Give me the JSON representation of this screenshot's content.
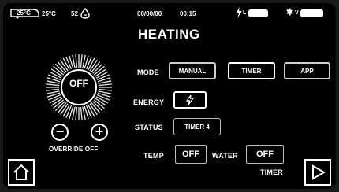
{
  "status_bar": {
    "cabin_temp": "25°C",
    "outside_temp": "25°C",
    "water_level": "52",
    "date": "00/00/00",
    "time": "00:15",
    "power_label": "L",
    "solar_label": "V"
  },
  "title": "HEATING",
  "dial": {
    "state": "OFF"
  },
  "override": {
    "label": "OVERRIDE OFF"
  },
  "mode": {
    "label": "MODE",
    "options": [
      "MANUAL",
      "TIMER",
      "APP"
    ],
    "selected": "TIMER"
  },
  "energy": {
    "label": "ENERGY",
    "icon": "lightning-icon"
  },
  "status": {
    "label": "STATUS",
    "value": "TIMER 4"
  },
  "temp": {
    "label": "TEMP",
    "value": "OFF"
  },
  "water": {
    "label": "WATER",
    "value": "OFF"
  },
  "footer": {
    "timer_label": "TIMER"
  }
}
